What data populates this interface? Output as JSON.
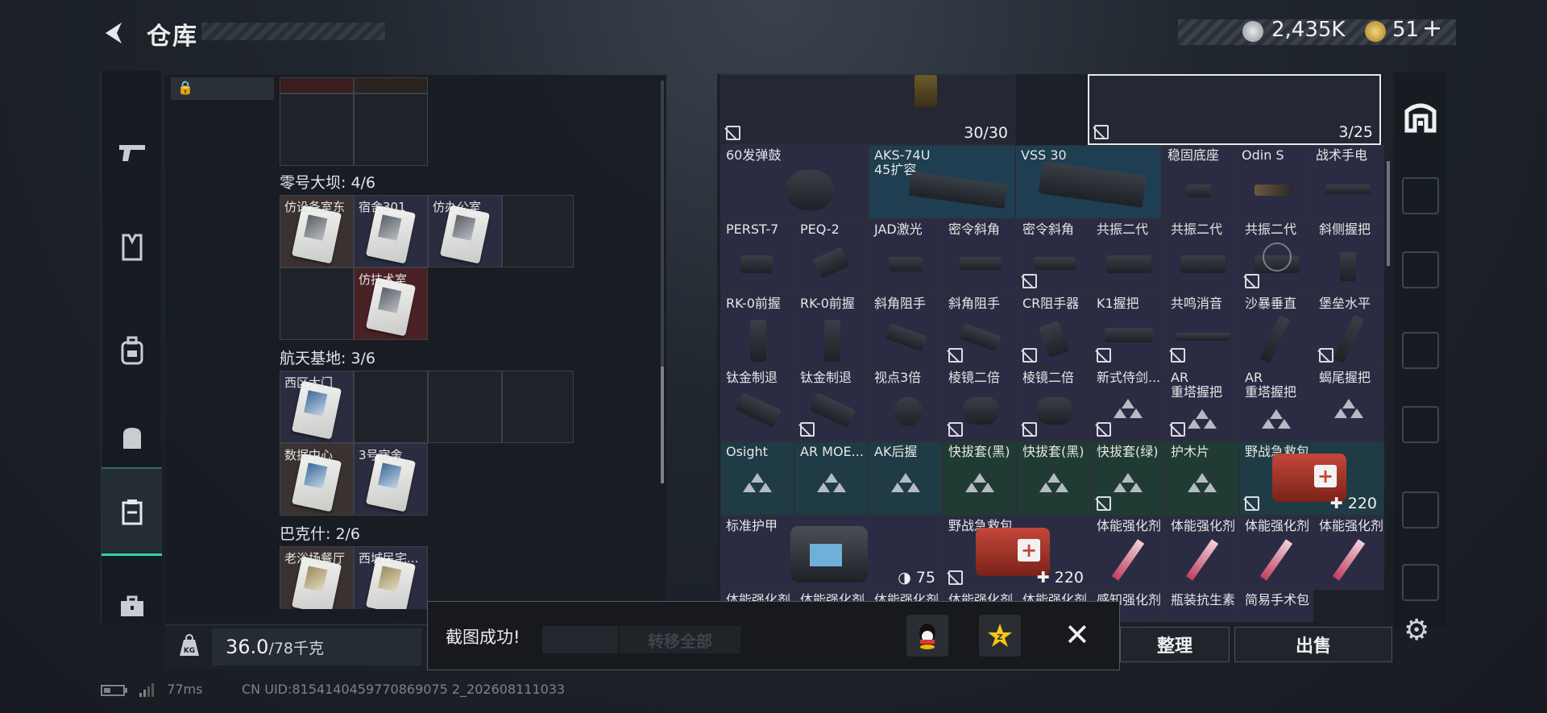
{
  "header": {
    "title": "仓库",
    "currency_silver": "2,435K",
    "currency_gold": "51",
    "add_symbol": "+"
  },
  "left_panel": {
    "groups": [
      {
        "label": "零号大坝: 4/6",
        "cards": [
          "仿设备室东",
          "宿舍301",
          "仿办公室",
          "仿技术室"
        ]
      },
      {
        "label": "航天基地: 3/6",
        "cards": [
          "西区大门",
          "数据中心",
          "3号宿舍"
        ]
      },
      {
        "label": "巴克什: 2/6",
        "cards": [
          "老浴场餐厅",
          "西城民宅..."
        ]
      }
    ],
    "weight_current": "36.0",
    "weight_max": "/78千克",
    "weight_icon_label": "KG"
  },
  "items": [
    {
      "name": "",
      "count": "30/30"
    },
    {
      "name": "",
      "count": "3/25"
    },
    {
      "name": "60发弹鼓"
    },
    {
      "name": "AKS-74U\n45扩容"
    },
    {
      "name": "VSS 30"
    },
    {
      "name": "稳固底座"
    },
    {
      "name": "Odin S"
    },
    {
      "name": "战术手电"
    },
    {
      "name": "PERST-7"
    },
    {
      "name": "PEQ-2"
    },
    {
      "name": "JAD激光"
    },
    {
      "name": "密令斜角"
    },
    {
      "name": "密令斜角"
    },
    {
      "name": "共振二代"
    },
    {
      "name": "共振二代"
    },
    {
      "name": "共振二代"
    },
    {
      "name": "斜侧握把"
    },
    {
      "name": "RK-0前握"
    },
    {
      "name": "RK-0前握"
    },
    {
      "name": "斜角阻手"
    },
    {
      "name": "斜角阻手"
    },
    {
      "name": "CR阻手器"
    },
    {
      "name": "K1握把"
    },
    {
      "name": "共鸣消音"
    },
    {
      "name": "沙暴垂直"
    },
    {
      "name": "堡垒水平"
    },
    {
      "name": "钛金制退"
    },
    {
      "name": "钛金制退"
    },
    {
      "name": "视点3倍"
    },
    {
      "name": "棱镜二倍"
    },
    {
      "name": "棱镜二倍"
    },
    {
      "name": "新式侍剑..."
    },
    {
      "name": "AR\n重塔握把"
    },
    {
      "name": "AR\n重塔握把"
    },
    {
      "name": "蝎尾握把"
    },
    {
      "name": "Osight"
    },
    {
      "name": "AR MOE..."
    },
    {
      "name": "AK后握"
    },
    {
      "name": "快拔套(黑)"
    },
    {
      "name": "快拔套(黑)"
    },
    {
      "name": "快拔套(绿)"
    },
    {
      "name": "护木片"
    },
    {
      "name": "野战急救包",
      "count": "220"
    },
    {
      "name": "标准护甲",
      "count": "75"
    },
    {
      "name": "野战急救包",
      "count": "220"
    },
    {
      "name": "体能强化剂"
    },
    {
      "name": "体能强化剂"
    },
    {
      "name": "体能强化剂"
    },
    {
      "name": "体能强化剂"
    },
    {
      "name": "体能强化剂"
    },
    {
      "name": "体能强化剂"
    },
    {
      "name": "体能强化剂"
    },
    {
      "name": "体能强化剂"
    },
    {
      "name": "体能强化剂"
    },
    {
      "name": "感知强化剂"
    },
    {
      "name": "瓶装抗生素"
    },
    {
      "name": "简易手术包"
    }
  ],
  "buttons": {
    "sort": "整理",
    "sell": "出售",
    "transfer_all": "转移全部"
  },
  "toast": {
    "message": "截图成功!"
  },
  "status": {
    "ping": "77ms",
    "uid": "CN UID:8154140459770869075 2_202608111033"
  },
  "colors": {
    "accent": "#36d0a0",
    "item_purple": "#2b2c43",
    "item_blue": "#1f3e52",
    "item_green": "#203b33"
  },
  "icons": [
    "back-arrow-icon",
    "pistol-icon",
    "vest-icon",
    "backpack-icon",
    "bag-icon",
    "storage-icon",
    "case-icon",
    "lock-icon",
    "kg-icon",
    "settings-icon",
    "qq-icon",
    "qzone-icon",
    "close-icon"
  ]
}
